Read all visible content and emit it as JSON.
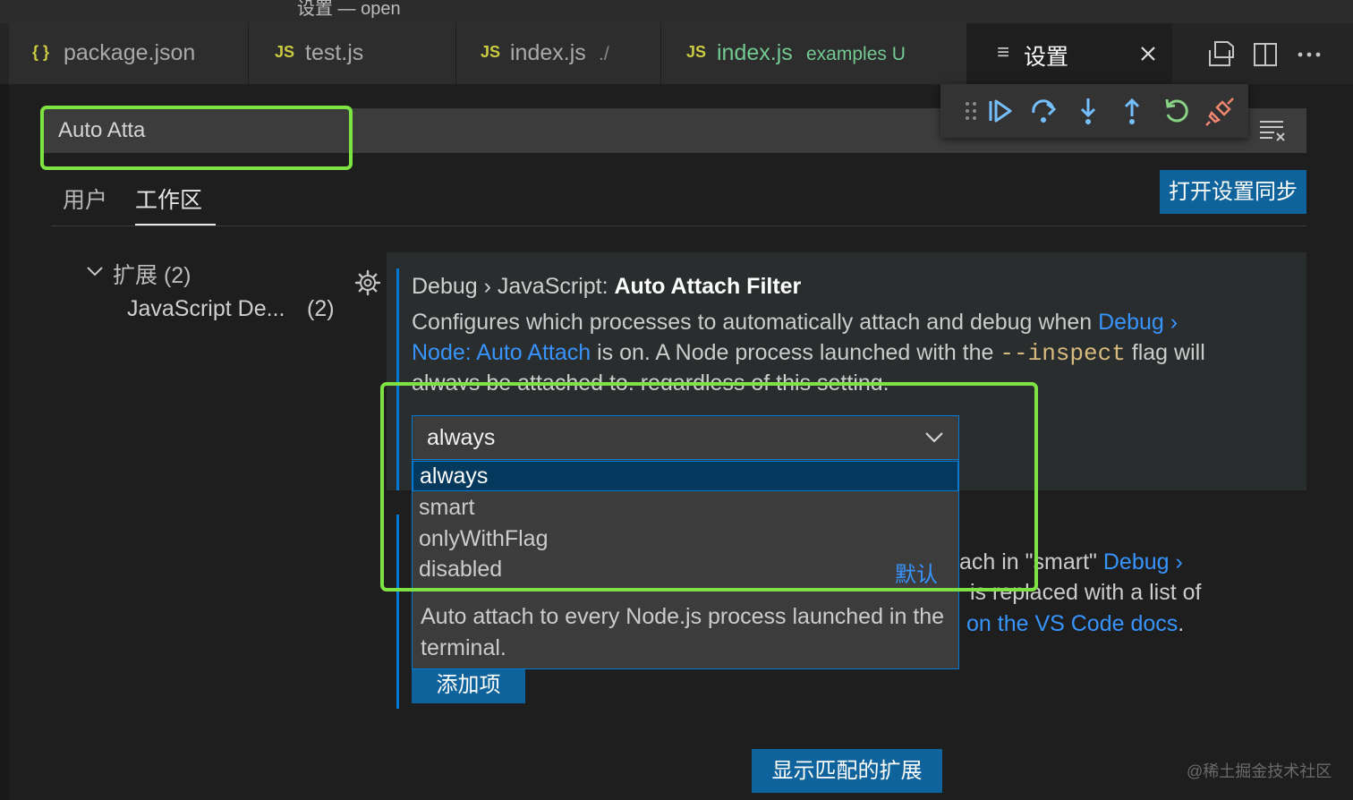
{
  "window": {
    "title": "设置 — open"
  },
  "tabs": [
    {
      "icon": "{ }",
      "label": "package.json",
      "desc": ""
    },
    {
      "icon": "JS",
      "label": "test.js",
      "desc": ""
    },
    {
      "icon": "JS",
      "label": "index.js",
      "desc": "./"
    },
    {
      "icon": "JS",
      "label": "index.js",
      "desc": "examples  U"
    },
    {
      "icon": "≡",
      "label": "设置",
      "desc": ""
    }
  ],
  "search": {
    "value": "Auto Atta"
  },
  "scopes": {
    "user": "用户",
    "workspace": "工作区"
  },
  "sync_button": "打开设置同步",
  "toc": {
    "group": "扩展 (2)",
    "item": "JavaScript De...",
    "item_count": "(2)"
  },
  "setting": {
    "breadcrumb": "Debug › JavaScript: ",
    "name": "Auto Attach Filter",
    "desc_line1": "Configures which processes to automatically attach and debug when ",
    "desc_link1": "Debug ›",
    "desc_link2": "Node: Auto Attach",
    "desc_line2a": " is on. A Node process launched with the ",
    "desc_code": "--inspect",
    "desc_line2b": " flag will",
    "desc_line3": "always be attached to, regardless of this setting.",
    "selected_value": "always",
    "options": [
      "always",
      "smart",
      "onlyWithFlag",
      "disabled"
    ],
    "default_label": "默认",
    "option_description": "Auto attach to every Node.js process launched in the terminal."
  },
  "second_setting": {
    "frag1": "ach in \"smart\" ",
    "frag1_link": "Debug ›",
    "frag2": "is replaced with a list of",
    "frag3_link": "on the VS Code docs",
    "frag3_end": ".",
    "add_item": "添加项"
  },
  "show_extensions_button": "显示匹配的扩展",
  "watermark": "@稀土掘金技术社区",
  "colors": {
    "accent": "#0078d4",
    "highlight": "#7ee342",
    "button": "#0e639c",
    "link": "#3794ff"
  }
}
